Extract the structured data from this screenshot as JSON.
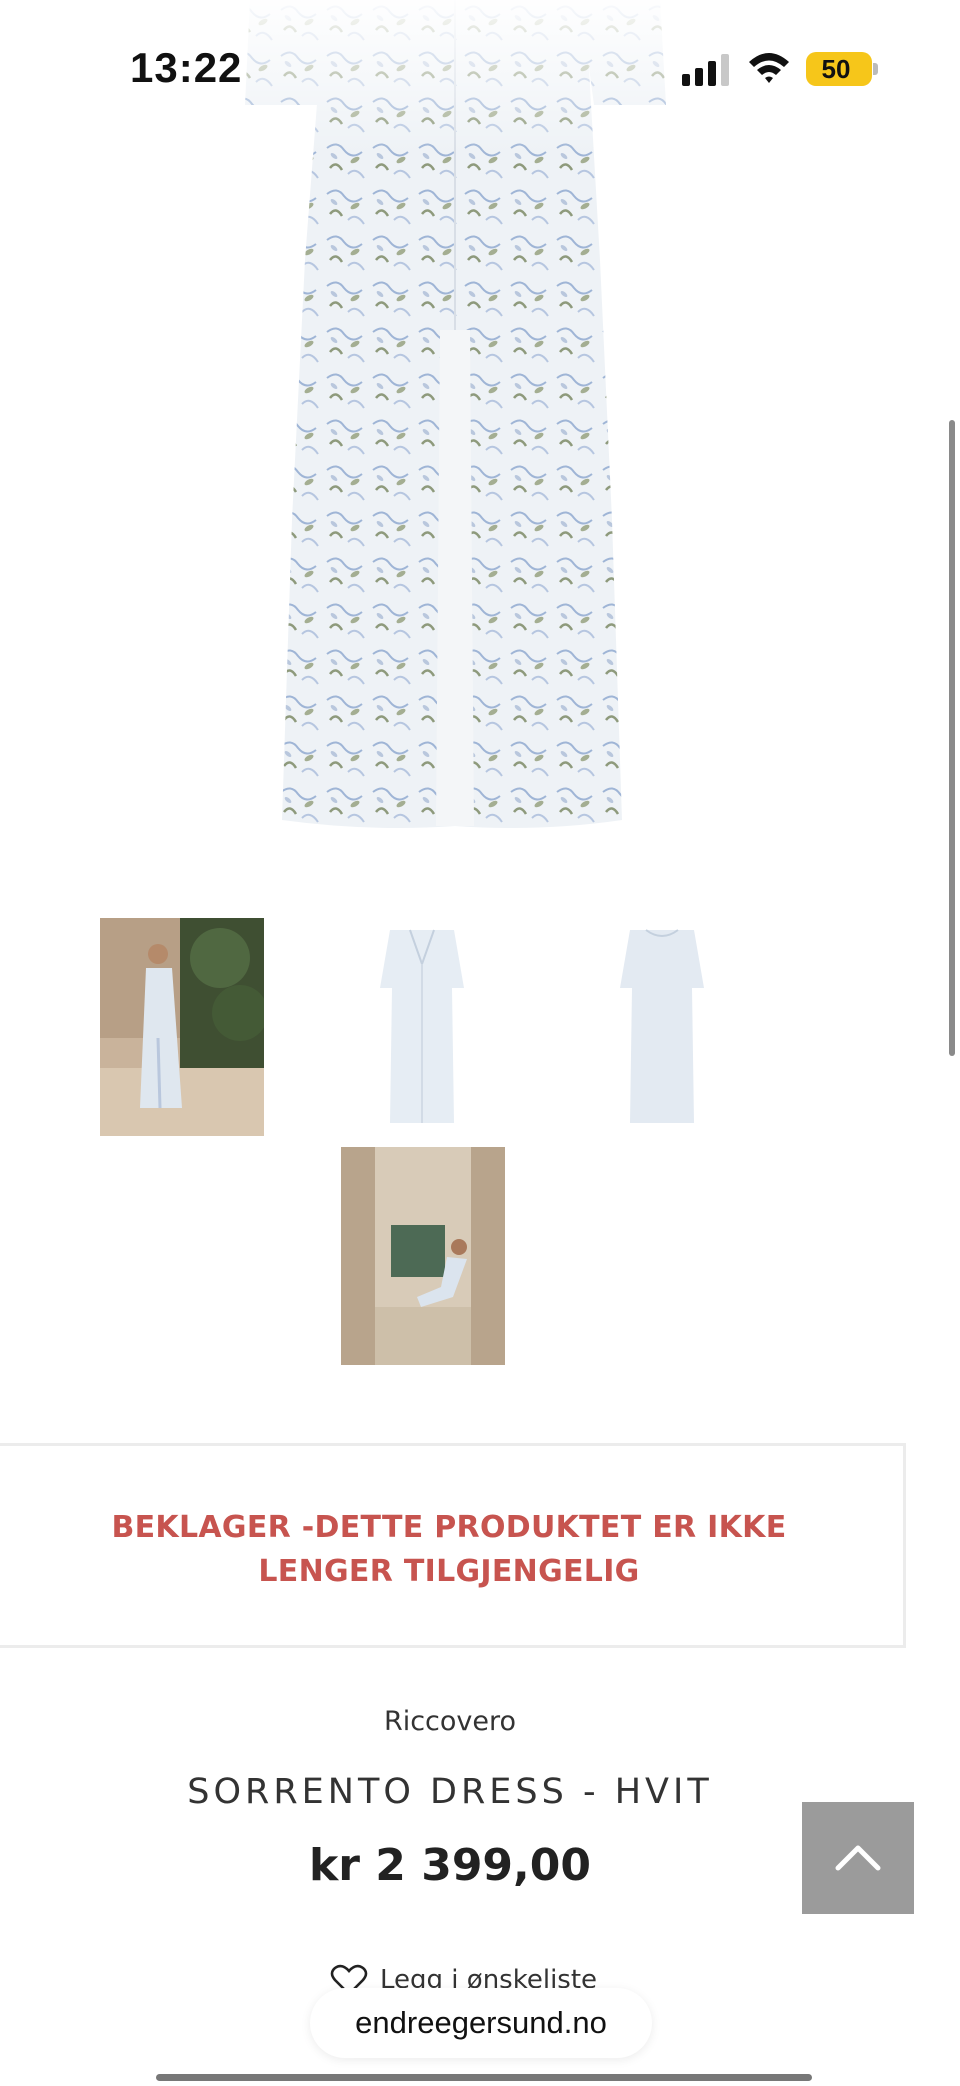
{
  "status_bar": {
    "time": "13:22",
    "battery_level": "50",
    "battery_color": "#f6c61a"
  },
  "gallery": {
    "main_image_alt": "Sorrento dress",
    "thumbnails": [
      "model-outdoor",
      "dress-front",
      "dress-back",
      "model-seated"
    ]
  },
  "notice": {
    "text": "BEKLAGER -DETTE PRODUKTET ER IKKE LENGER TILGJENGELIG",
    "color": "#c7544f"
  },
  "product": {
    "brand": "Riccovero",
    "title": "SORRENTO DRESS - HVIT",
    "price": "kr 2 399,00"
  },
  "wishlist": {
    "label": "Legg i ønskeliste",
    "icon": "heart-icon"
  },
  "browser": {
    "url": "endreegersund.no"
  },
  "controls": {
    "back_to_top_icon": "chevron-up-icon"
  }
}
